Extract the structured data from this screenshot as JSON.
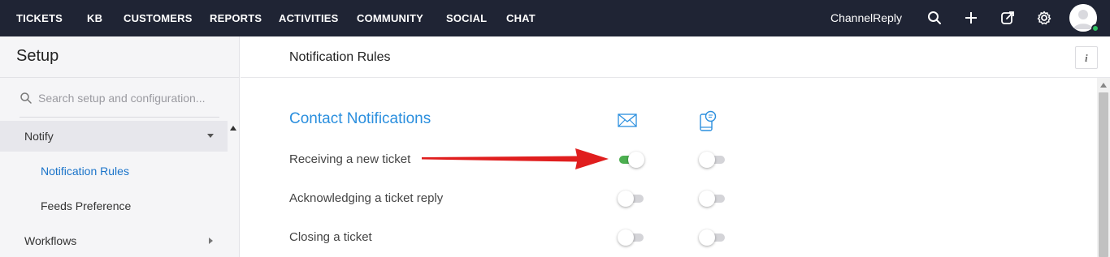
{
  "topnav": {
    "items": [
      "TICKETS",
      "KB",
      "CUSTOMERS",
      "REPORTS",
      "ACTIVITIES",
      "COMMUNITY",
      "SOCIAL",
      "CHAT"
    ],
    "brand": "ChannelReply",
    "icons": [
      "search-icon",
      "plus-icon",
      "compose-icon",
      "gear-icon"
    ],
    "user_status_color": "#2ec061"
  },
  "sidebar": {
    "title": "Setup",
    "search_placeholder": "Search setup and configuration...",
    "items": [
      {
        "label": "Notify",
        "expanded": true
      },
      {
        "label": "Notification Rules",
        "selected": true
      },
      {
        "label": "Feeds Preference"
      },
      {
        "label": "Workflows",
        "expanded": false
      }
    ]
  },
  "main": {
    "title": "Notification Rules",
    "info_label": "i",
    "section_title": "Contact Notifications",
    "columns": [
      {
        "icon": "envelope-icon"
      },
      {
        "icon": "mobile-chat-icon"
      }
    ],
    "rows": [
      {
        "label": "Receiving a new ticket",
        "email": true,
        "mobile": false
      },
      {
        "label": "Acknowledging a ticket reply",
        "email": false,
        "mobile": false
      },
      {
        "label": "Closing a ticket",
        "email": false,
        "mobile": false
      }
    ]
  },
  "colors": {
    "topbar_bg": "#1f2434",
    "accent_blue": "#2b8fde",
    "toggle_on": "#4caf50",
    "arrow_red": "#e01e1e"
  }
}
